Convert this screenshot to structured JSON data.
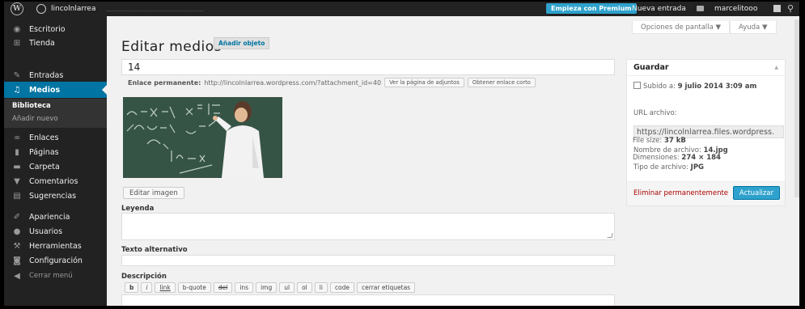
{
  "adminbar": {
    "site_name": "lincolnlarrea",
    "premium_label": "Empieza con Premium",
    "new_entry_label": "Nueva entrada",
    "user_name": "marcelitooo"
  },
  "sidebar": {
    "items": [
      {
        "label": "Escritorio",
        "icon": "dashboard-icon"
      },
      {
        "label": "Tienda",
        "icon": "cart-icon"
      },
      {
        "label": "Entradas",
        "icon": "pin-icon"
      },
      {
        "label": "Medios",
        "icon": "media-icon"
      },
      {
        "label": "Enlaces",
        "icon": "link-icon"
      },
      {
        "label": "Páginas",
        "icon": "pages-icon"
      },
      {
        "label": "Carpeta",
        "icon": "folder-icon"
      },
      {
        "label": "Comentarios",
        "icon": "comment-icon"
      },
      {
        "label": "Sugerencias",
        "icon": "feedback-icon"
      },
      {
        "label": "Apariencia",
        "icon": "brush-icon"
      },
      {
        "label": "Usuarios",
        "icon": "users-icon"
      },
      {
        "label": "Herramientas",
        "icon": "wrench-icon"
      },
      {
        "label": "Configuración",
        "icon": "settings-icon"
      },
      {
        "label": "Cerrar menú",
        "icon": "collapse-icon"
      }
    ],
    "submenu": {
      "library": "Biblioteca",
      "add_new": "Añadir nuevo"
    }
  },
  "header": {
    "screen_options": "Opciones de pantalla ▼",
    "help": "Ayuda ▼",
    "title": "Editar medios",
    "add_new": "Añadir objeto"
  },
  "editor": {
    "title_value": "14",
    "permalink_label": "Enlace permanente:",
    "permalink_url": "http://lincolnlarrea.wordpress.com/?attachment_id=40",
    "view_attachment_page": "Ver la página de adjuntos",
    "get_shortlink": "Obtener enlace corto",
    "edit_image": "Editar imagen",
    "caption_label": "Leyenda",
    "alt_label": "Texto alternativo",
    "description_label": "Descripción",
    "quicktags": [
      "b",
      "i",
      "link",
      "b-quote",
      "del",
      "ins",
      "img",
      "ul",
      "ol",
      "li",
      "code",
      "cerrar etiquetas"
    ]
  },
  "save_box": {
    "title": "Guardar",
    "uploaded_label": "Subido a:",
    "uploaded_value": "9 julio 2014 3:09 am",
    "file_url_label": "URL archivo:",
    "file_url": "https://lincolnlarrea.files.wordpress.",
    "file_name_label": "Nombre de archivo:",
    "file_name": "14.jpg",
    "file_type_label": "Tipo de archivo:",
    "file_type": "JPG",
    "file_size_label": "File size:",
    "file_size": "37 kB",
    "dimensions_label": "Dimensiones:",
    "dimensions": "274 × 184",
    "delete_label": "Eliminar permanentemente",
    "update_label": "Actualizar"
  },
  "colors": {
    "accent": "#0074a2",
    "button": "#2ea2cc",
    "sidebar_bg": "#222222",
    "delete": "#aa0000"
  }
}
